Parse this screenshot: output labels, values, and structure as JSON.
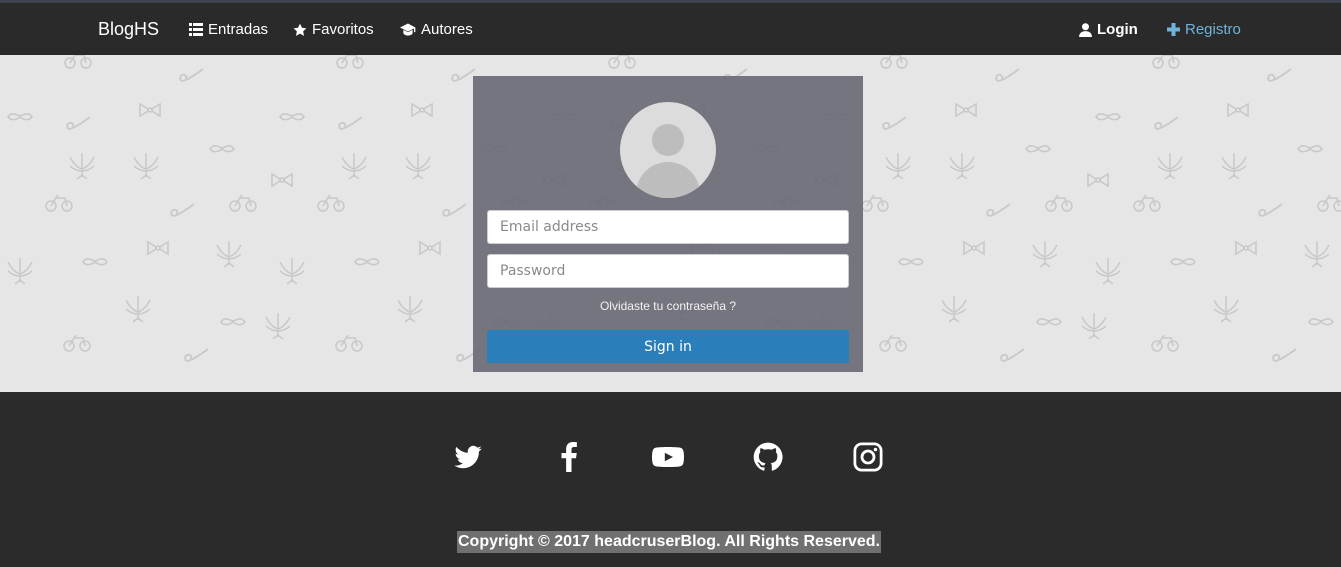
{
  "nav": {
    "brand": "BlogHS",
    "entradas": "Entradas",
    "favoritos": "Favoritos",
    "autores": "Autores",
    "login": "Login",
    "registro": "Registro"
  },
  "login_form": {
    "email_placeholder": "Email address",
    "password_placeholder": "Password",
    "forgot_link": "Olvidaste tu contraseña ?",
    "signin_label": "Sign in"
  },
  "footer": {
    "social": [
      "twitter-icon",
      "facebook-icon",
      "youtube-icon",
      "github-icon",
      "instagram-icon"
    ],
    "copyright": "Copyright © 2017 headcruserBlog. All Rights Reserved."
  },
  "colors": {
    "navbar": "#2a2a2a",
    "registro_link": "#6fb3d8",
    "signin_button": "#2a7fbb",
    "page_background": "#e6e6e6",
    "footer": "#2b2b2b"
  }
}
